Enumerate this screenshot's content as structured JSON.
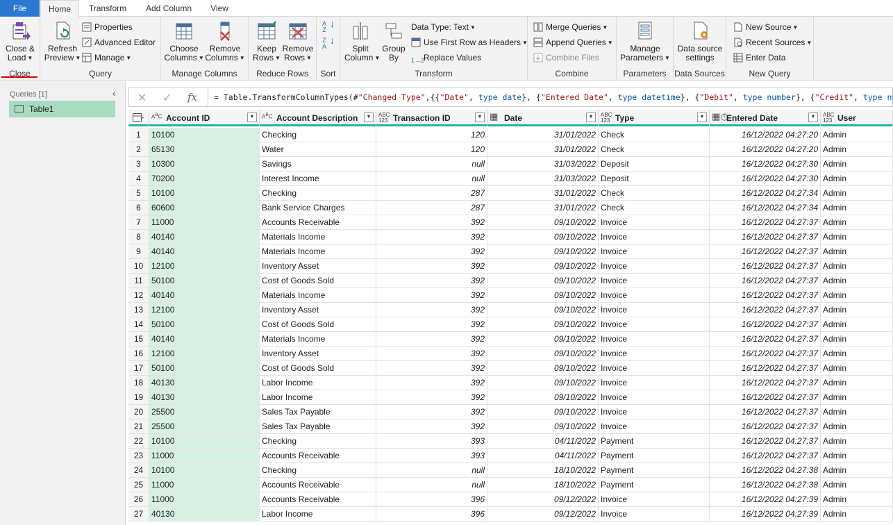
{
  "tabs": {
    "file": "File",
    "home": "Home",
    "transform": "Transform",
    "add_column": "Add Column",
    "view": "View"
  },
  "ribbon": {
    "close_load": [
      "Close &",
      "Load"
    ],
    "close_group": "Close",
    "refresh_preview": [
      "Refresh",
      "Preview"
    ],
    "properties": "Properties",
    "advanced_editor": "Advanced Editor",
    "manage": "Manage",
    "query_group": "Query",
    "choose_columns": [
      "Choose",
      "Columns"
    ],
    "remove_columns": [
      "Remove",
      "Columns"
    ],
    "manage_columns_group": "Manage Columns",
    "keep_rows": [
      "Keep",
      "Rows"
    ],
    "remove_rows": [
      "Remove",
      "Rows"
    ],
    "reduce_rows_group": "Reduce Rows",
    "sort_group": "Sort",
    "split_column": [
      "Split",
      "Column"
    ],
    "group_by": [
      "Group",
      "By"
    ],
    "data_type": "Data Type: Text",
    "use_first_row": "Use First Row as Headers",
    "replace_values": "Replace Values",
    "transform_group": "Transform",
    "merge_queries": "Merge Queries",
    "append_queries": "Append Queries",
    "combine_files": "Combine Files",
    "combine_group": "Combine",
    "manage_parameters": [
      "Manage",
      "Parameters"
    ],
    "parameters_group": "Parameters",
    "data_source_settings": [
      "Data source",
      "settings"
    ],
    "data_sources_group": "Data Sources",
    "new_source": "New Source",
    "recent_sources": "Recent Sources",
    "enter_data": "Enter Data",
    "new_query_group": "New Query"
  },
  "queries_pane": {
    "header": "Queries [1]",
    "items": [
      "Table1"
    ]
  },
  "formula": {
    "parts": [
      {
        "t": "= Table.TransformColumnTypes(#",
        "c": ""
      },
      {
        "t": "\"Changed Type\"",
        "c": "s"
      },
      {
        "t": ",{{",
        "c": ""
      },
      {
        "t": "\"Date\"",
        "c": "s"
      },
      {
        "t": ", ",
        "c": ""
      },
      {
        "t": "type date",
        "c": "k"
      },
      {
        "t": "}, {",
        "c": ""
      },
      {
        "t": "\"Entered Date\"",
        "c": "s"
      },
      {
        "t": ", ",
        "c": ""
      },
      {
        "t": "type datetime",
        "c": "k"
      },
      {
        "t": "}, {",
        "c": ""
      },
      {
        "t": "\"Debit\"",
        "c": "s"
      },
      {
        "t": ", ",
        "c": ""
      },
      {
        "t": "type number",
        "c": "k"
      },
      {
        "t": "}, {",
        "c": ""
      },
      {
        "t": "\"Credit\"",
        "c": "s"
      },
      {
        "t": ", ",
        "c": ""
      },
      {
        "t": "type number",
        "c": "k"
      },
      {
        "t": "}}",
        "c": ""
      }
    ]
  },
  "grid": {
    "columns": [
      {
        "label": "Account ID",
        "type": "ABC"
      },
      {
        "label": "Account Description",
        "type": "ABC"
      },
      {
        "label": "Transaction ID",
        "type": "ABC123"
      },
      {
        "label": "Date",
        "type": "date"
      },
      {
        "label": "Type",
        "type": "ABC123"
      },
      {
        "label": "Entered Date",
        "type": "datetime"
      },
      {
        "label": "User",
        "type": "ABC123"
      }
    ],
    "rows": [
      [
        "1",
        "10100",
        "Checking",
        "120",
        "31/01/2022",
        "Check",
        "16/12/2022 04:27:20",
        "Admin"
      ],
      [
        "2",
        "65130",
        "Water",
        "120",
        "31/01/2022",
        "Check",
        "16/12/2022 04:27:20",
        "Admin"
      ],
      [
        "3",
        "10300",
        "Savings",
        "null",
        "31/03/2022",
        "Deposit",
        "16/12/2022 04:27:30",
        "Admin"
      ],
      [
        "4",
        "70200",
        "Interest Income",
        "null",
        "31/03/2022",
        "Deposit",
        "16/12/2022 04:27:30",
        "Admin"
      ],
      [
        "5",
        "10100",
        "Checking",
        "287",
        "31/01/2022",
        "Check",
        "16/12/2022 04:27:34",
        "Admin"
      ],
      [
        "6",
        "60600",
        "Bank Service Charges",
        "287",
        "31/01/2022",
        "Check",
        "16/12/2022 04:27:34",
        "Admin"
      ],
      [
        "7",
        "11000",
        "Accounts Receivable",
        "392",
        "09/10/2022",
        "Invoice",
        "16/12/2022 04:27:37",
        "Admin"
      ],
      [
        "8",
        "40140",
        "Materials Income",
        "392",
        "09/10/2022",
        "Invoice",
        "16/12/2022 04:27:37",
        "Admin"
      ],
      [
        "9",
        "40140",
        "Materials Income",
        "392",
        "09/10/2022",
        "Invoice",
        "16/12/2022 04:27:37",
        "Admin"
      ],
      [
        "10",
        "12100",
        "Inventory Asset",
        "392",
        "09/10/2022",
        "Invoice",
        "16/12/2022 04:27:37",
        "Admin"
      ],
      [
        "11",
        "50100",
        "Cost of Goods Sold",
        "392",
        "09/10/2022",
        "Invoice",
        "16/12/2022 04:27:37",
        "Admin"
      ],
      [
        "12",
        "40140",
        "Materials Income",
        "392",
        "09/10/2022",
        "Invoice",
        "16/12/2022 04:27:37",
        "Admin"
      ],
      [
        "13",
        "12100",
        "Inventory Asset",
        "392",
        "09/10/2022",
        "Invoice",
        "16/12/2022 04:27:37",
        "Admin"
      ],
      [
        "14",
        "50100",
        "Cost of Goods Sold",
        "392",
        "09/10/2022",
        "Invoice",
        "16/12/2022 04:27:37",
        "Admin"
      ],
      [
        "15",
        "40140",
        "Materials Income",
        "392",
        "09/10/2022",
        "Invoice",
        "16/12/2022 04:27:37",
        "Admin"
      ],
      [
        "16",
        "12100",
        "Inventory Asset",
        "392",
        "09/10/2022",
        "Invoice",
        "16/12/2022 04:27:37",
        "Admin"
      ],
      [
        "17",
        "50100",
        "Cost of Goods Sold",
        "392",
        "09/10/2022",
        "Invoice",
        "16/12/2022 04:27:37",
        "Admin"
      ],
      [
        "18",
        "40130",
        "Labor Income",
        "392",
        "09/10/2022",
        "Invoice",
        "16/12/2022 04:27:37",
        "Admin"
      ],
      [
        "19",
        "40130",
        "Labor Income",
        "392",
        "09/10/2022",
        "Invoice",
        "16/12/2022 04:27:37",
        "Admin"
      ],
      [
        "20",
        "25500",
        "Sales Tax Payable",
        "392",
        "09/10/2022",
        "Invoice",
        "16/12/2022 04:27:37",
        "Admin"
      ],
      [
        "21",
        "25500",
        "Sales Tax Payable",
        "392",
        "09/10/2022",
        "Invoice",
        "16/12/2022 04:27:37",
        "Admin"
      ],
      [
        "22",
        "10100",
        "Checking",
        "393",
        "04/11/2022",
        "Payment",
        "16/12/2022 04:27:37",
        "Admin"
      ],
      [
        "23",
        "11000",
        "Accounts Receivable",
        "393",
        "04/11/2022",
        "Payment",
        "16/12/2022 04:27:37",
        "Admin"
      ],
      [
        "24",
        "10100",
        "Checking",
        "null",
        "18/10/2022",
        "Payment",
        "16/12/2022 04:27:38",
        "Admin"
      ],
      [
        "25",
        "11000",
        "Accounts Receivable",
        "null",
        "18/10/2022",
        "Payment",
        "16/12/2022 04:27:38",
        "Admin"
      ],
      [
        "26",
        "11000",
        "Accounts Receivable",
        "396",
        "09/12/2022",
        "Invoice",
        "16/12/2022 04:27:39",
        "Admin"
      ],
      [
        "27",
        "40130",
        "Labor Income",
        "396",
        "09/12/2022",
        "Invoice",
        "16/12/2022 04:27:39",
        "Admin"
      ]
    ]
  },
  "colors": {
    "file_tab": "#2b79d0",
    "selected_column": "#d8f0e2",
    "query_selected": "#a8dcc0",
    "header_underline": "#1fb5a0"
  }
}
